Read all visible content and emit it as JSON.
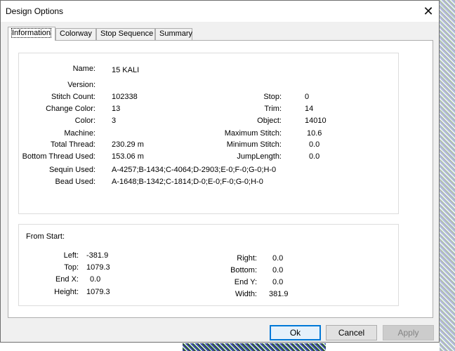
{
  "window": {
    "title": "Design Options",
    "close_glyph": "✕"
  },
  "tabs": [
    {
      "label": "Information",
      "active": true
    },
    {
      "label": "Colorway",
      "active": false
    },
    {
      "label": "Stop Sequence",
      "active": false
    },
    {
      "label": "Summary",
      "active": false
    }
  ],
  "info": {
    "name": {
      "label": "Name:",
      "value": "15 KALI"
    },
    "version": {
      "label": "Version:",
      "value": ""
    },
    "stitch_count": {
      "label": "Stitch Count:",
      "value": "102338"
    },
    "change_color": {
      "label": "Change Color:",
      "value": "13"
    },
    "color": {
      "label": "Color:",
      "value": "3"
    },
    "machine": {
      "label": "Machine:",
      "value": ""
    },
    "total_thread": {
      "label": "Total Thread:",
      "value": "230.29 m"
    },
    "bottom_thread_used": {
      "label": "Bottom Thread Used:",
      "value": "153.06 m"
    },
    "sequin_used": {
      "label": "Sequin Used:",
      "value": "A-4257;B-1434;C-4064;D-2903;E-0;F-0;G-0;H-0"
    },
    "bead_used": {
      "label": "Bead Used:",
      "value": "A-1648;B-1342;C-1814;D-0;E-0;F-0;G-0;H-0"
    },
    "stop": {
      "label": "Stop:",
      "value": "0"
    },
    "trim": {
      "label": "Trim:",
      "value": "14"
    },
    "object": {
      "label": "Object:",
      "value": "14010"
    },
    "maximum_stitch": {
      "label": "Maximum Stitch:",
      "value": "10.6"
    },
    "minimum_stitch": {
      "label": "Minimum Stitch:",
      "value": "0.0"
    },
    "jump_length": {
      "label": "JumpLength:",
      "value": "0.0"
    }
  },
  "from_start": {
    "heading": "From Start:",
    "left": {
      "label": "Left:",
      "value": "-381.9"
    },
    "top": {
      "label": "Top:",
      "value": "1079.3"
    },
    "end_x": {
      "label": "End X:",
      "value": "0.0"
    },
    "height": {
      "label": "Height:",
      "value": "1079.3"
    },
    "right": {
      "label": "Right:",
      "value": "0.0"
    },
    "bottom": {
      "label": "Bottom:",
      "value": "0.0"
    },
    "end_y": {
      "label": "End Y:",
      "value": "0.0"
    },
    "width": {
      "label": "Width:",
      "value": "381.9"
    }
  },
  "buttons": {
    "ok": "Ok",
    "cancel": "Cancel",
    "apply": "Apply"
  }
}
